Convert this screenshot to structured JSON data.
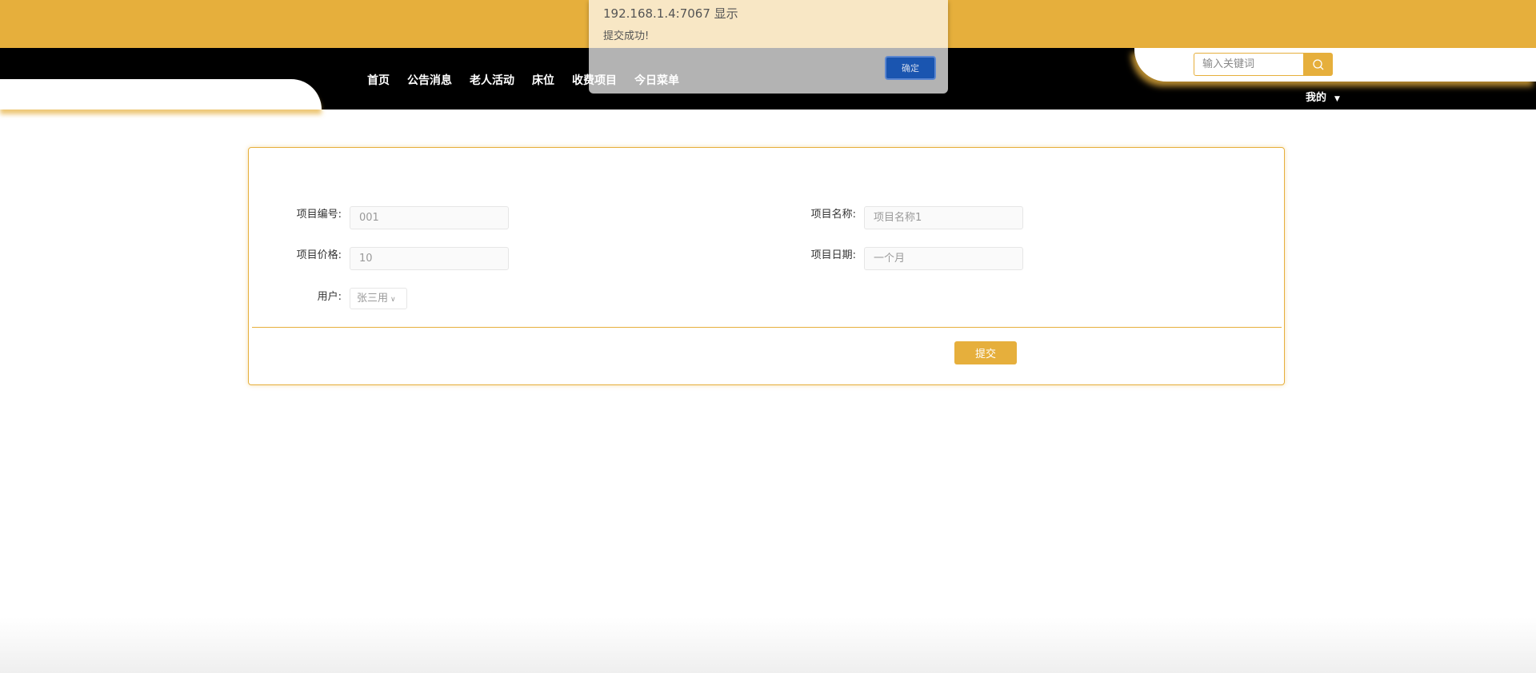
{
  "nav": {
    "items": [
      "首页",
      "公告消息",
      "老人活动",
      "床位",
      "收费项目",
      "今日菜单"
    ],
    "mine": "我的"
  },
  "search": {
    "placeholder": "输入关键词"
  },
  "form": {
    "code_label": "项目编号:",
    "code_value": "001",
    "name_label": "项目名称:",
    "name_value": "项目名称1",
    "price_label": "项目价格:",
    "price_value": "10",
    "date_label": "项目日期:",
    "date_value": "一个月",
    "user_label": "用户:",
    "user_value": "张三用",
    "submit": "提交"
  },
  "dialog": {
    "title": "192.168.1.4:7067 显示",
    "message": "提交成功!",
    "ok": "确定"
  },
  "colors": {
    "accent": "#e6af3c",
    "dialog_button": "#1a55b0"
  }
}
